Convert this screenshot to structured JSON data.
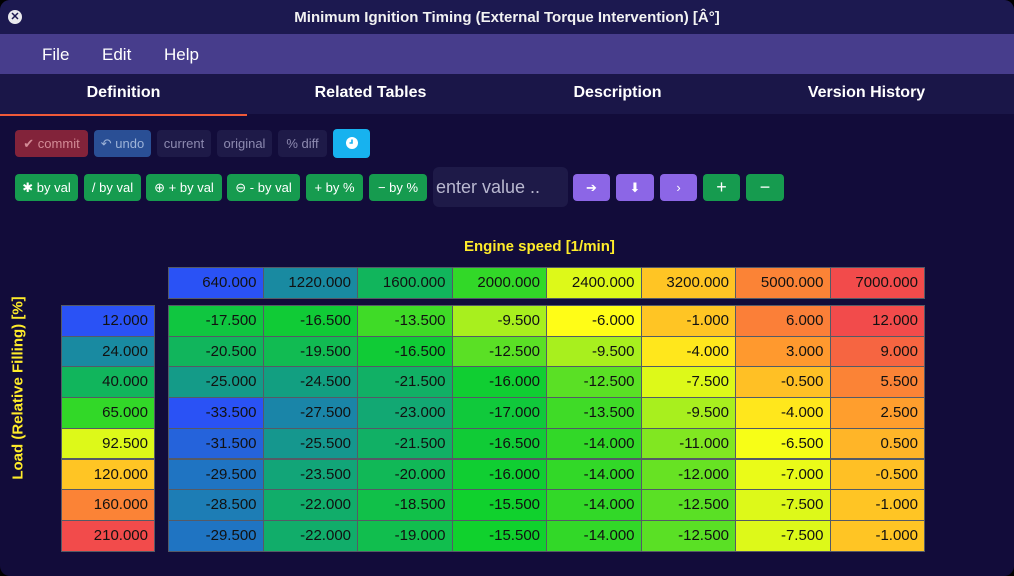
{
  "window": {
    "title": "Minimum Ignition Timing (External Torque Intervention) [Â°]",
    "close_symbol": "✕"
  },
  "menu": [
    "File",
    "Edit",
    "Help"
  ],
  "tabs": [
    "Definition",
    "Related Tables",
    "Description",
    "Version History"
  ],
  "active_tab": "Definition",
  "toolbar": {
    "commit": "✔ commit",
    "undo": "↶ undo",
    "current": "current",
    "original": "original",
    "diff": "% diff",
    "clock_icon": "clock-icon",
    "ops": [
      "✱ by val",
      "/ by val",
      "⊕ + by val",
      "⊖ - by val",
      "+ by %",
      "− by %"
    ],
    "value_placeholder": "enter value ..",
    "nav": [
      "➔",
      "⬇",
      "›",
      "+",
      "−"
    ]
  },
  "table": {
    "x_title": "Engine speed [1/min]",
    "y_title": "Load (Relative Filling) [%]",
    "x_axis": [
      "640.000",
      "1220.000",
      "1600.000",
      "2000.000",
      "2400.000",
      "3200.000",
      "5000.000",
      "7000.000"
    ],
    "y_axis": [
      "12.000",
      "24.000",
      "40.000",
      "65.000",
      "92.500",
      "120.000",
      "160.000",
      "210.000"
    ],
    "values": [
      [
        -17.5,
        -16.5,
        -13.5,
        -9.5,
        -6.0,
        -1.0,
        6.0,
        12.0
      ],
      [
        -20.5,
        -19.5,
        -16.5,
        -12.5,
        -9.5,
        -4.0,
        3.0,
        9.0
      ],
      [
        -25.0,
        -24.5,
        -21.5,
        -16.0,
        -12.5,
        -7.5,
        -0.5,
        5.5
      ],
      [
        -33.5,
        -27.5,
        -23.0,
        -17.0,
        -13.5,
        -9.5,
        -4.0,
        2.5
      ],
      [
        -31.5,
        -25.5,
        -21.5,
        -16.5,
        -14.0,
        -11.0,
        -6.5,
        0.5
      ],
      [
        -29.5,
        -23.5,
        -20.0,
        -16.0,
        -14.0,
        -12.0,
        -7.0,
        -0.5
      ],
      [
        -28.5,
        -22.0,
        -18.5,
        -15.5,
        -14.0,
        -12.5,
        -7.5,
        -1.0
      ],
      [
        -29.5,
        -22.0,
        -19.0,
        -15.5,
        -14.0,
        -12.5,
        -7.5,
        -1.0
      ]
    ],
    "colors": {
      "blue": "#2a52f5",
      "teal": "#12a080",
      "green": "#10d22b",
      "yellow": "#ffff16",
      "orange": "#ff9a2e",
      "red": "#f24b4b"
    }
  }
}
